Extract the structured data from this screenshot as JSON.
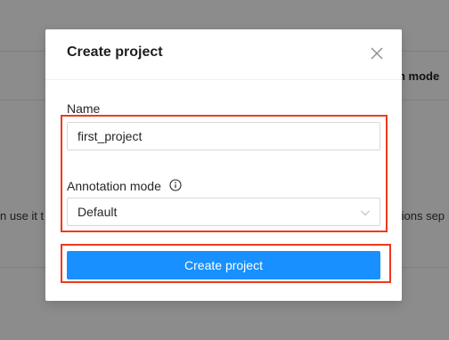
{
  "background": {
    "right_heading": "n mode",
    "left_text": "n use it t",
    "right_text": "tions sep"
  },
  "modal": {
    "title": "Create project",
    "close_icon": "close-icon",
    "name_label": "Name",
    "name_value": "first_project",
    "annotation_label": "Annotation mode",
    "info_icon": "info-circle-icon",
    "annotation_value": "Default",
    "chevron_icon": "chevron-down-icon",
    "submit_label": "Create project"
  },
  "colors": {
    "primary": "#1890ff",
    "highlight": "#ee3a1d"
  }
}
